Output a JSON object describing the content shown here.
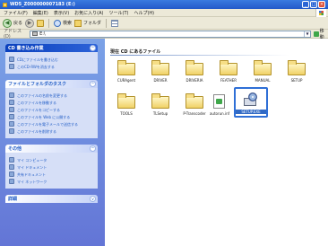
{
  "window": {
    "title": "WD5_Z000000007183 (E:)",
    "controls": [
      "_",
      "□",
      "×"
    ]
  },
  "menubar": {
    "items": [
      "ファイル(F)",
      "編集(E)",
      "表示(V)",
      "お気に入り(A)",
      "ツール(T)",
      "ヘルプ(H)"
    ]
  },
  "toolbar": {
    "back_label": "戻る",
    "forward_label": "",
    "search_label": "検索",
    "folders_label": "フォルダ"
  },
  "addressbar": {
    "label": "アドレス(D)",
    "value": "E:\\",
    "go_label": "移動"
  },
  "taskpane": {
    "panels": [
      {
        "title": "CD 書き込み作業",
        "style": "dark",
        "items": [
          "CDにファイルを書き込む",
          "このCD-RWを消去する"
        ]
      },
      {
        "title": "ファイルとフォルダのタスク",
        "style": "light",
        "items": [
          "このファイルの名前を変更する",
          "このファイルを移動する",
          "このファイルをコピーする",
          "このファイルを Web に公開する",
          "このファイルを電子メールで送信する",
          "このファイルを削除する"
        ]
      },
      {
        "title": "その他",
        "style": "light",
        "items": [
          "マイ コンピュータ",
          "マイ ドキュメント",
          "共有ドキュメント",
          "マイ ネットワーク"
        ]
      },
      {
        "title": "詳細",
        "style": "light",
        "items": []
      }
    ]
  },
  "content": {
    "group_header": "現在 CD にあるファイル",
    "items": [
      {
        "label": "CURAgent",
        "type": "folder"
      },
      {
        "label": "DRIVER",
        "type": "folder"
      },
      {
        "label": "DRIVERIA",
        "type": "folder"
      },
      {
        "label": "FEATHER",
        "type": "folder"
      },
      {
        "label": "MANUAL",
        "type": "folder"
      },
      {
        "label": "SETUP",
        "type": "folder"
      },
      {
        "label": "TOOLS",
        "type": "folder"
      },
      {
        "label": "TLSetup",
        "type": "folder"
      },
      {
        "label": "P-Transcoder",
        "type": "folder"
      },
      {
        "label": "autorun.inf",
        "type": "file"
      },
      {
        "label": "SETUP.EXE",
        "type": "setup",
        "selected": true
      }
    ]
  }
}
